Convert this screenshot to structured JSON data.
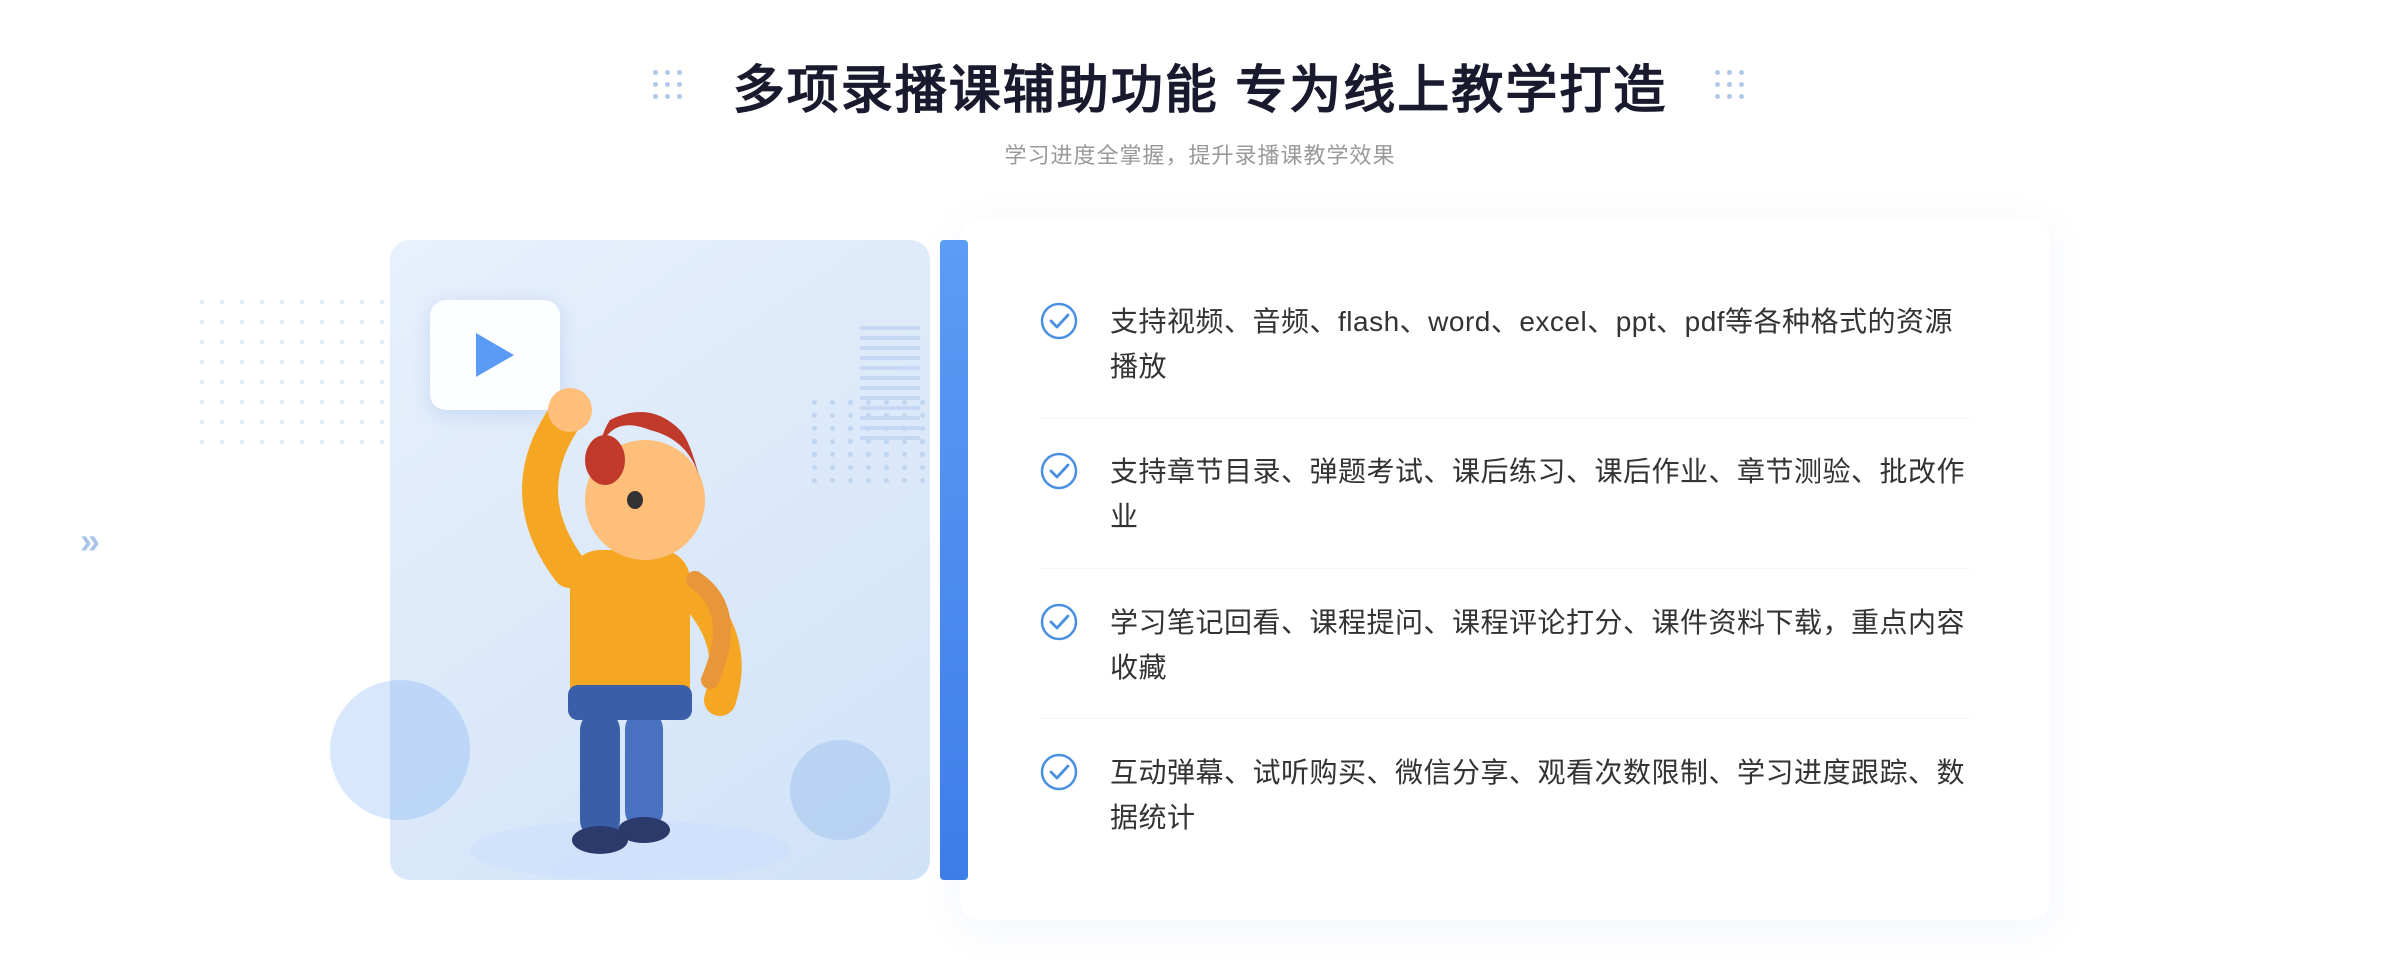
{
  "header": {
    "main_title": "多项录播课辅助功能 专为线上教学打造",
    "sub_title": "学习进度全掌握，提升录播课教学效果"
  },
  "features": [
    {
      "id": "feature-1",
      "text": "支持视频、音频、flash、word、excel、ppt、pdf等各种格式的资源播放"
    },
    {
      "id": "feature-2",
      "text": "支持章节目录、弹题考试、课后练习、课后作业、章节测验、批改作业"
    },
    {
      "id": "feature-3",
      "text": "学习笔记回看、课程提问、课程评论打分、课件资料下载，重点内容收藏"
    },
    {
      "id": "feature-4",
      "text": "互动弹幕、试听购买、微信分享、观看次数限制、学习进度跟踪、数据统计"
    }
  ],
  "colors": {
    "primary_blue": "#4a90e2",
    "light_blue": "#5b9cf6",
    "check_color": "#4a90e2",
    "title_color": "#1a1a2e",
    "text_color": "#333333",
    "sub_color": "#999999"
  },
  "icons": {
    "check": "check-circle-icon",
    "play": "play-icon",
    "arrow_left": "chevron-double-left-icon",
    "arrow_right": "chevron-double-right-icon"
  }
}
